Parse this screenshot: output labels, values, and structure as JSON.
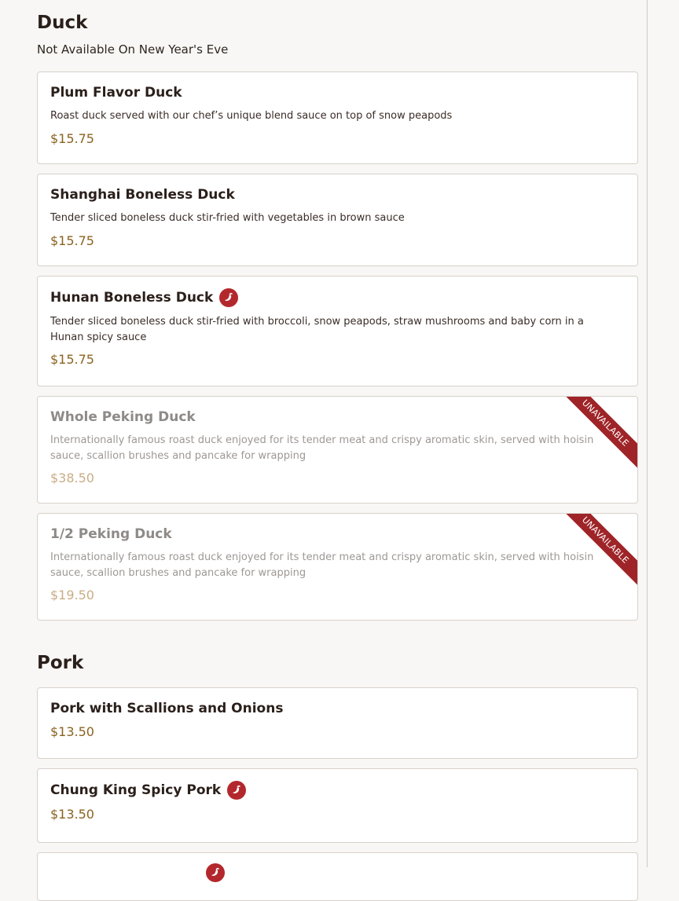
{
  "colors": {
    "background": "#f8f7f5",
    "card_border": "#d7d1ca",
    "price": "#8a6420",
    "spicy": "#b3282d",
    "ribbon": "#9e2428"
  },
  "sections": [
    {
      "title": "Duck",
      "note": "Not Available On New Year's Eve",
      "items": [
        {
          "name": "Plum Flavor Duck",
          "description": "Roast duck served with our chef’s unique blend sauce on top of snow peapods",
          "price": "$15.75",
          "spicy": false,
          "available": true
        },
        {
          "name": "Shanghai Boneless Duck",
          "description": "Tender sliced boneless duck stir-fried with vegetables in brown sauce",
          "price": "$15.75",
          "spicy": false,
          "available": true
        },
        {
          "name": "Hunan Boneless Duck",
          "description": "Tender sliced boneless duck stir-fried with broccoli, snow peapods, straw mushrooms and baby corn in a Hunan spicy sauce",
          "price": "$15.75",
          "spicy": true,
          "spicy_icon": "chili-pepper-icon",
          "available": true
        },
        {
          "name": "Whole Peking Duck",
          "description": "Internationally famous roast duck enjoyed for its tender meat and crispy aromatic skin, served with hoisin sauce, scallion brushes and pancake for wrapping",
          "price": "$38.50",
          "spicy": false,
          "available": false,
          "badge": "UNAVAILABLE"
        },
        {
          "name": "1/2 Peking Duck",
          "description": "Internationally famous roast duck enjoyed for its tender meat and crispy aromatic skin, served with hoisin sauce, scallion brushes and pancake for wrapping",
          "price": "$19.50",
          "spicy": false,
          "available": false,
          "badge": "UNAVAILABLE"
        }
      ]
    },
    {
      "title": "Pork",
      "items": [
        {
          "name": "Pork with Scallions and Onions",
          "price": "$13.50",
          "spicy": false,
          "available": true
        },
        {
          "name": "Chung King Spicy Pork",
          "price": "$13.50",
          "spicy": true,
          "spicy_icon": "chili-pepper-icon",
          "available": true
        }
      ]
    }
  ]
}
